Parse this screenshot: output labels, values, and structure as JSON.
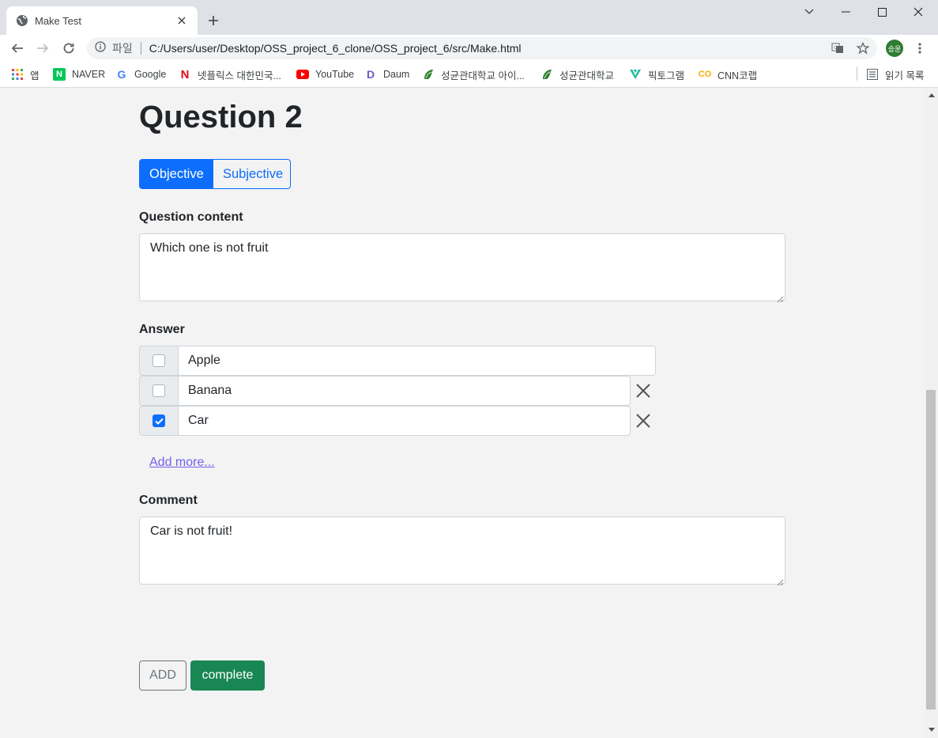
{
  "browser": {
    "tab_title": "Make Test",
    "scheme_label": "파일",
    "url": "C:/Users/user/Desktop/OSS_project_6_clone/OSS_project_6/src/Make.html",
    "profile_initials": "승윤",
    "bookmarks": [
      {
        "label": "앱",
        "icon": "apps-grid-icon"
      },
      {
        "label": "NAVER",
        "icon": "naver-icon",
        "color": "#03c75a"
      },
      {
        "label": "Google",
        "icon": "google-icon",
        "color": "#4285f4"
      },
      {
        "label": "넷플릭스 대한민국...",
        "icon": "netflix-icon",
        "color": "#e50914"
      },
      {
        "label": "YouTube",
        "icon": "youtube-icon",
        "color": "#ff0000"
      },
      {
        "label": "Daum",
        "icon": "daum-icon",
        "color": "#6a5acd"
      },
      {
        "label": "성균관대학교 아이...",
        "icon": "skku-icon",
        "color": "#2e7d32"
      },
      {
        "label": "성균관대학교",
        "icon": "skku-icon",
        "color": "#2e7d32"
      },
      {
        "label": "픽토그램",
        "icon": "pictogram-icon",
        "color": "#1fb89a"
      },
      {
        "label": "CNN코랩",
        "icon": "colab-icon",
        "color": "#f9ab00"
      }
    ],
    "reading_list_label": "읽기 목록"
  },
  "page": {
    "question_title": "Question 2",
    "type_toggle": {
      "objective": "Objective",
      "subjective": "Subjective",
      "selected": "Objective"
    },
    "question_content_label": "Question content",
    "question_content_value": "Which one is not fruit",
    "answer_label": "Answer",
    "answers": [
      {
        "text": "Apple",
        "checked": false,
        "deletable": false
      },
      {
        "text": "Banana",
        "checked": false,
        "deletable": true
      },
      {
        "text": "Car",
        "checked": true,
        "deletable": true
      }
    ],
    "add_more_label": "Add more...",
    "comment_label": "Comment",
    "comment_value": "Car is not fruit!",
    "add_button": "ADD",
    "complete_button": "complete"
  },
  "colors": {
    "primary": "#0d6efd",
    "success": "#198754",
    "secondary": "#6c757d",
    "link": "#6f61e8"
  }
}
